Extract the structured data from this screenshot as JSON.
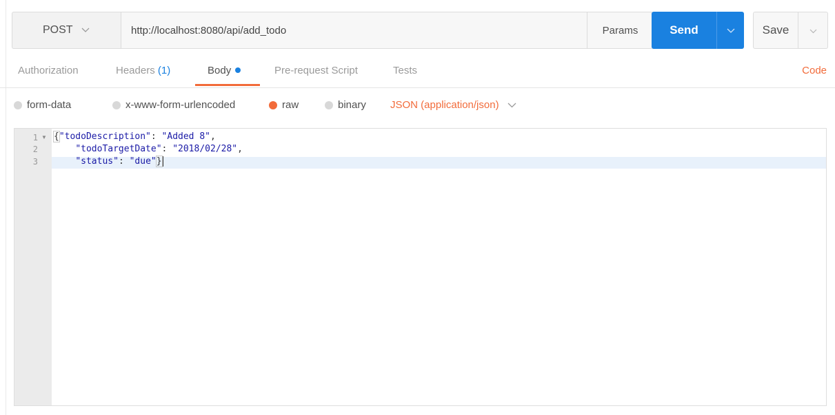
{
  "request": {
    "method": "POST",
    "url": "http://localhost:8080/api/add_todo",
    "params_label": "Params",
    "send_label": "Send",
    "save_label": "Save"
  },
  "tabs": [
    {
      "label": "Authorization"
    },
    {
      "label": "Headers",
      "count": "(1)"
    },
    {
      "label": "Body"
    },
    {
      "label": "Pre-request Script"
    },
    {
      "label": "Tests"
    }
  ],
  "active_tab": "Body",
  "code_link": "Code",
  "body_options": [
    {
      "label": "form-data",
      "selected": false
    },
    {
      "label": "x-www-form-urlencoded",
      "selected": false
    },
    {
      "label": "raw",
      "selected": true
    },
    {
      "label": "binary",
      "selected": false
    }
  ],
  "content_type": "JSON (application/json)",
  "editor": {
    "line_numbers": [
      "1",
      "2",
      "3"
    ],
    "lines": [
      {
        "key": "\"todoDescription\"",
        "sep": ": ",
        "value": "\"Added 8\"",
        "end": ","
      },
      {
        "key": "\"todoTargetDate\"",
        "sep": ": ",
        "value": "\"2018/02/28\"",
        "end": ","
      },
      {
        "key": "\"status\"",
        "sep": ": ",
        "value": "\"due\"",
        "end": "}"
      }
    ]
  },
  "colors": {
    "accent_blue": "#1a81e0",
    "accent_orange": "#f26b3a"
  },
  "icons": {
    "method_dropdown": "chevron-down-icon",
    "send_dropdown": "chevron-down-icon",
    "save_dropdown": "chevron-down-icon",
    "content_type_dropdown": "chevron-down-icon",
    "fold": "fold-arrow-icon"
  }
}
